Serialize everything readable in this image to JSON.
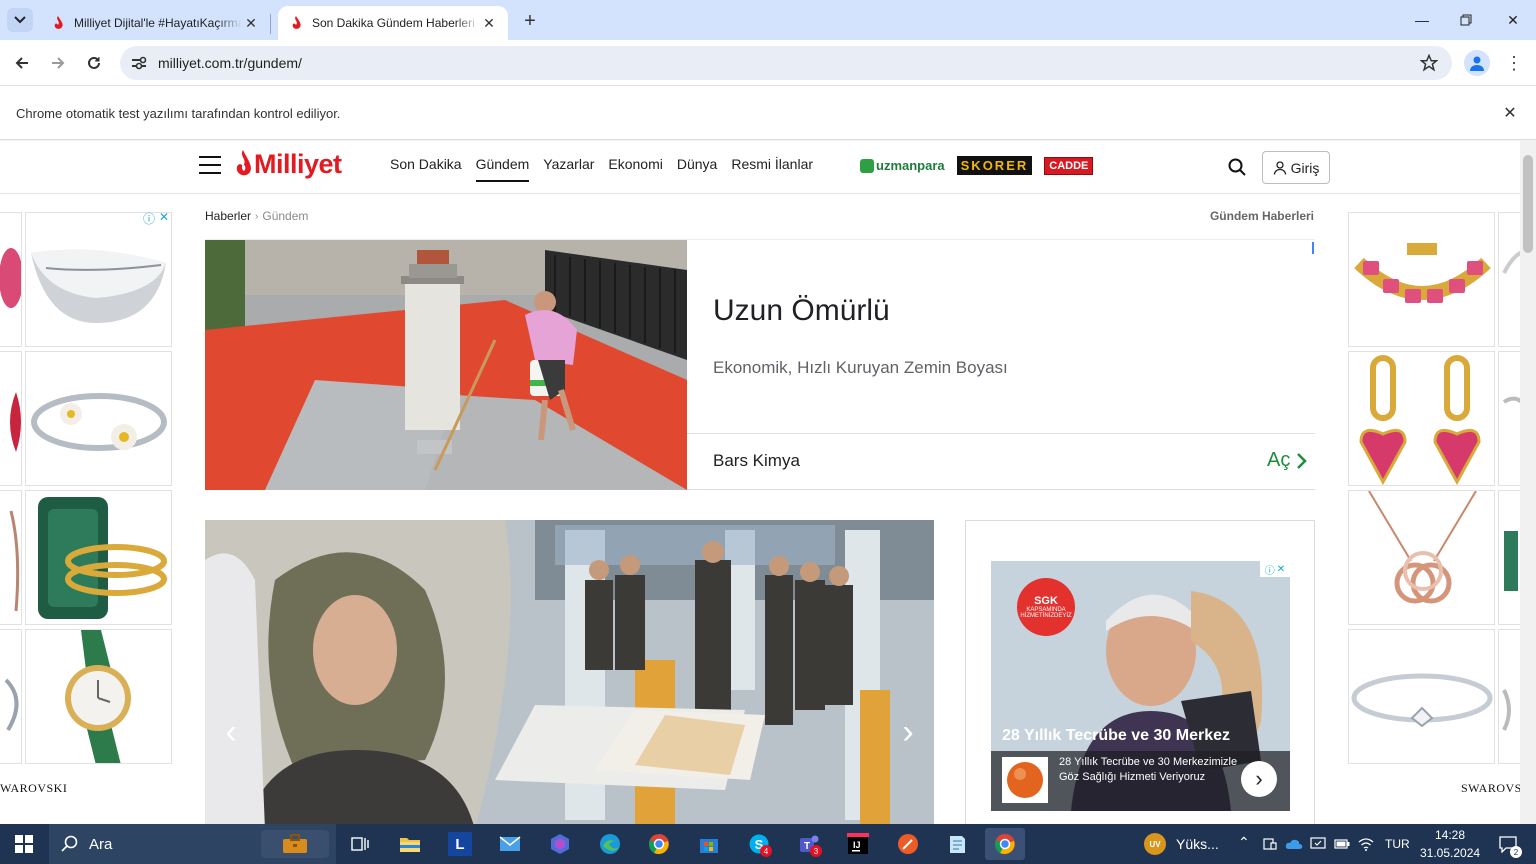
{
  "browser": {
    "tabs": [
      {
        "title": "Milliyet Dijital'le #HayatıKaçırma",
        "active": false
      },
      {
        "title": "Son Dakika Gündem Haberleri",
        "active": true
      }
    ],
    "url": "milliyet.com.tr/gundem/",
    "infobar": "Chrome otomatik test yazılımı tarafından kontrol ediliyor."
  },
  "site": {
    "logo": "Milliyet",
    "nav": [
      "Son Dakika",
      "Gündem",
      "Yazarlar",
      "Ekonomi",
      "Dünya",
      "Resmi İlanlar"
    ],
    "active_nav": "Gündem",
    "partners": {
      "uzman": "uzmanpara",
      "skorer": "SKORER",
      "cadde": "CADDE"
    },
    "login": "Giriş"
  },
  "breadcrumb": {
    "root": "Haberler",
    "current": "Gündem"
  },
  "section_title": "Gündem Haberleri",
  "ad_banner": {
    "title": "Uzun Ömürlü",
    "description": "Ekonomik, Hızlı Kuruyan Zemin Boyası",
    "brand": "Bars Kimya",
    "cta": "Aç"
  },
  "right_ad": {
    "badge_top": "SGK",
    "badge_sub": "KAPSAMINDA HİZMETİNİZDEYİZ",
    "headline": "28 Yıllık Tecrübe ve 30 Merkez",
    "sub": "28 Yıllık Tecrübe ve 30 Merkezimizle Göz Sağlığı Hizmeti Veriyoruz"
  },
  "side_ads": {
    "brand": "SWAROVSKI",
    "brand_left": "WAROVSKI"
  },
  "taskbar": {
    "search_placeholder": "Ara",
    "weather": "Yüks...",
    "lang": "TUR",
    "time": "14:28",
    "date": "31.05.2024",
    "notifications": "2",
    "teams_badge": "3",
    "skype_badge": "4",
    "weather_badge": "UV"
  }
}
